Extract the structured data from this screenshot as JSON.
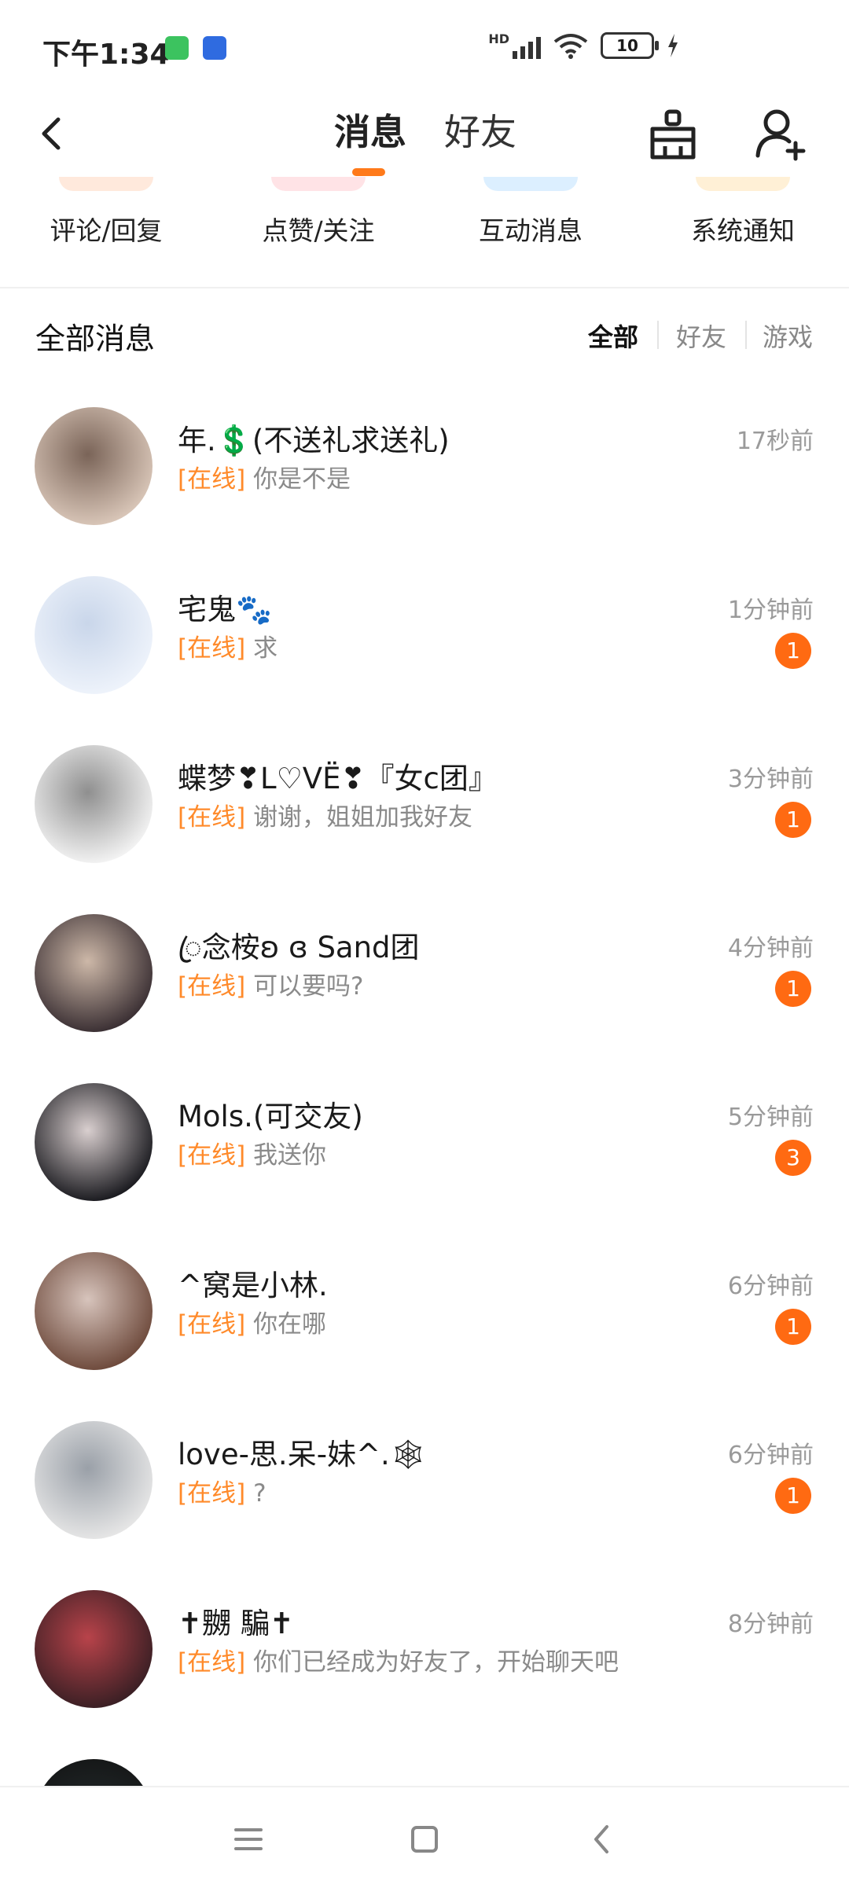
{
  "status_bar": {
    "time": "下午1:34",
    "network": "HD",
    "battery": "10"
  },
  "header": {
    "tab_messages": "消息",
    "tab_friends": "好友"
  },
  "categories": [
    {
      "label": "评论/回复",
      "color": "#ffe9dc"
    },
    {
      "label": "点赞/关注",
      "color": "#ffe3e6"
    },
    {
      "label": "互动消息",
      "color": "#dcefff"
    },
    {
      "label": "系统通知",
      "color": "#fff0d6"
    }
  ],
  "messages_header": {
    "title": "全部消息",
    "filters": [
      "全部",
      "好友",
      "游戏"
    ]
  },
  "online_tag": "[在线]",
  "conversations": [
    {
      "name": "年.💲(不送礼求送礼)",
      "preview": "你是不是",
      "time": "17秒前",
      "badge": "",
      "avatar_colors": [
        "#d9c6b8",
        "#7a6458"
      ]
    },
    {
      "name": "宅鬼🐾",
      "preview": "求",
      "time": "1分钟前",
      "badge": "1",
      "avatar_colors": [
        "#eef3fb",
        "#c9d6ea"
      ]
    },
    {
      "name": "蝶梦❣L♡VË❣『女c团』",
      "preview": "谢谢，姐姐加我好友",
      "time": "3分钟前",
      "badge": "1",
      "avatar_colors": [
        "#f3f3f3",
        "#8f8f8f"
      ]
    },
    {
      "name": "ꦿ念桉ʚ ɞ Sand团",
      "preview": "可以要吗?",
      "time": "4分钟前",
      "badge": "1",
      "avatar_colors": [
        "#3a2f33",
        "#cdb8a8"
      ]
    },
    {
      "name": "Mols.(可交友)",
      "preview": "我送你",
      "time": "5分钟前",
      "badge": "3",
      "avatar_colors": [
        "#1a1a1f",
        "#d9cfcf"
      ]
    },
    {
      "name": "^窝是小林.",
      "preview": "你在哪",
      "time": "6分钟前",
      "badge": "1",
      "avatar_colors": [
        "#6e4a3c",
        "#d7c4bc"
      ]
    },
    {
      "name": "love-思.呆-妹^.🕸",
      "preview": "?",
      "time": "6分钟前",
      "badge": "1",
      "avatar_colors": [
        "#e6e6e6",
        "#9aa0a8"
      ]
    },
    {
      "name": "✝嬲 騙✝",
      "preview": "你们已经成为好友了，开始聊天吧",
      "time": "8分钟前",
      "badge": "",
      "avatar_colors": [
        "#3a1f24",
        "#b8434a"
      ]
    }
  ]
}
